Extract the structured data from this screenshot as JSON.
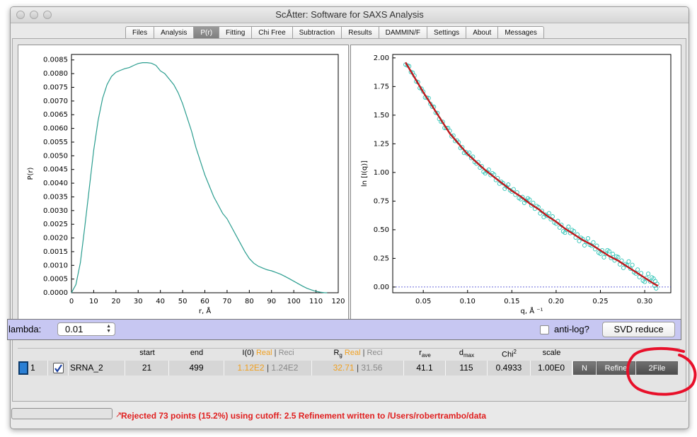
{
  "window": {
    "title": "ScÅtter: Software for SAXS Analysis"
  },
  "tabs": [
    "Files",
    "Analysis",
    "P(r)",
    "Fitting",
    "Chi Free",
    "Subtraction",
    "Results",
    "DAMMIN/F",
    "Settings",
    "About",
    "Messages"
  ],
  "active_tab": "P(r)",
  "left_plot": {
    "ylabel": "P(r)",
    "xlabel": "r, Å",
    "yticks": [
      "0.0000",
      "0.0005",
      "0.0010",
      "0.0015",
      "0.0020",
      "0.0025",
      "0.0030",
      "0.0035",
      "0.0040",
      "0.0045",
      "0.0050",
      "0.0055",
      "0.0060",
      "0.0065",
      "0.0070",
      "0.0075",
      "0.0080",
      "0.0085"
    ],
    "xticks": [
      "0",
      "10",
      "20",
      "30",
      "40",
      "50",
      "60",
      "70",
      "80",
      "90",
      "100",
      "110",
      "120"
    ]
  },
  "right_plot": {
    "ylabel": "ln [I(q)]",
    "xlabel": "q, Å ⁻¹",
    "yticks": [
      "0.00",
      "0.25",
      "0.50",
      "0.75",
      "1.00",
      "1.25",
      "1.50",
      "1.75",
      "2.00"
    ],
    "xticks": [
      "0.05",
      "0.10",
      "0.15",
      "0.20",
      "0.25",
      "0.30"
    ]
  },
  "chart_data": [
    {
      "type": "line",
      "xlabel": "r, Å",
      "ylabel": "P(r)",
      "xlim": [
        0,
        120
      ],
      "ylim": [
        0,
        0.0087
      ],
      "series": [
        {
          "color": "#2a9d8f",
          "x": [
            0,
            2,
            4,
            6,
            8,
            10,
            12,
            14,
            16,
            18,
            20,
            22,
            24,
            26,
            28,
            30,
            32,
            34,
            36,
            38,
            40,
            42,
            44,
            46,
            48,
            50,
            52,
            54,
            56,
            58,
            60,
            62,
            64,
            66,
            68,
            70,
            72,
            74,
            76,
            78,
            80,
            82,
            84,
            86,
            88,
            90,
            92,
            94,
            96,
            98,
            100,
            102,
            104,
            106,
            108,
            110,
            112,
            114,
            115
          ],
          "y": [
            0,
            0.0003,
            0.0011,
            0.0024,
            0.0038,
            0.0052,
            0.0063,
            0.0071,
            0.0076,
            0.0079,
            0.00805,
            0.00812,
            0.00818,
            0.00822,
            0.0083,
            0.00837,
            0.0084,
            0.0084,
            0.00838,
            0.0083,
            0.0081,
            0.008,
            0.0078,
            0.0076,
            0.0073,
            0.0069,
            0.0064,
            0.0059,
            0.0053,
            0.0048,
            0.0043,
            0.0039,
            0.0035,
            0.0032,
            0.0029,
            0.0027,
            0.0024,
            0.0021,
            0.0018,
            0.0015,
            0.00125,
            0.00108,
            0.00097,
            0.0009,
            0.00084,
            0.0008,
            0.00074,
            0.00068,
            0.0006,
            0.00051,
            0.00042,
            0.00033,
            0.00024,
            0.00016,
            0.0001,
            5e-05,
            2e-05,
            0,
            0
          ]
        }
      ]
    },
    {
      "type": "scatter",
      "xlabel": "q, Å ⁻¹",
      "ylabel": "ln [I(q)]",
      "xlim": [
        0.0155,
        0.3295
      ],
      "ylim": [
        -0.05,
        2.03
      ],
      "series": [
        {
          "color": "#2ec4b6",
          "x": [
            0.03,
            0.04,
            0.05,
            0.06,
            0.07,
            0.08,
            0.09,
            0.1,
            0.11,
            0.12,
            0.13,
            0.14,
            0.15,
            0.16,
            0.17,
            0.18,
            0.19,
            0.2,
            0.21,
            0.22,
            0.23,
            0.24,
            0.25,
            0.26,
            0.27,
            0.28,
            0.29,
            0.3,
            0.31,
            0.315
          ],
          "y": [
            1.96,
            1.83,
            1.7,
            1.58,
            1.46,
            1.34,
            1.25,
            1.16,
            1.09,
            1.02,
            0.96,
            0.9,
            0.84,
            0.79,
            0.73,
            0.68,
            0.62,
            0.57,
            0.51,
            0.46,
            0.41,
            0.37,
            0.32,
            0.27,
            0.24,
            0.19,
            0.14,
            0.09,
            0.04,
            0.01
          ]
        },
        {
          "color": "#c0181c",
          "x": [
            0.03,
            0.04,
            0.05,
            0.06,
            0.07,
            0.08,
            0.09,
            0.1,
            0.11,
            0.12,
            0.13,
            0.14,
            0.15,
            0.16,
            0.17,
            0.18,
            0.19,
            0.2,
            0.21,
            0.22,
            0.23,
            0.24,
            0.25,
            0.26,
            0.27,
            0.28,
            0.29,
            0.3,
            0.31,
            0.315
          ],
          "y": [
            1.96,
            1.83,
            1.7,
            1.58,
            1.46,
            1.34,
            1.25,
            1.16,
            1.09,
            1.02,
            0.96,
            0.9,
            0.84,
            0.79,
            0.73,
            0.68,
            0.62,
            0.57,
            0.51,
            0.46,
            0.41,
            0.37,
            0.32,
            0.27,
            0.23,
            0.18,
            0.13,
            0.08,
            0.03,
            0.01
          ]
        }
      ]
    }
  ],
  "controls": {
    "lambda_label": "lambda:",
    "lambda_value": "0.01",
    "antilog_label": "anti-log?",
    "svd_label": "SVD reduce"
  },
  "table": {
    "headers": {
      "start": "start",
      "end": "end",
      "i0": "I(0)",
      "rg": "R",
      "rg_sub": "g",
      "real": "Real",
      "reci": "Reci",
      "rave": "r",
      "rave_sub": "ave",
      "dmax": "d",
      "dmax_sub": "max",
      "chi": "Chi",
      "chi_sup": "2",
      "scale": "scale"
    },
    "row": {
      "index": "1",
      "name": "SRNA_2",
      "start": "21",
      "end": "499",
      "i0_real": "1.12E2",
      "i0_reci": "1.24E2",
      "rg_real": "32.71",
      "rg_reci": "31.56",
      "rave": "41.1",
      "dmax": "115",
      "chi2": "0.4933",
      "scale": "1.00E0",
      "n_label": "N",
      "refine_label": "Refine",
      "tofile_label": "2File"
    }
  },
  "status": "Rejected 73 points (15.2%) using cutoff: 2.5 Refinement written to /Users/robertrambo/data",
  "colors": {
    "accent": "#c7c7f2",
    "status": "#e02020",
    "annotation": "#e8102a"
  }
}
